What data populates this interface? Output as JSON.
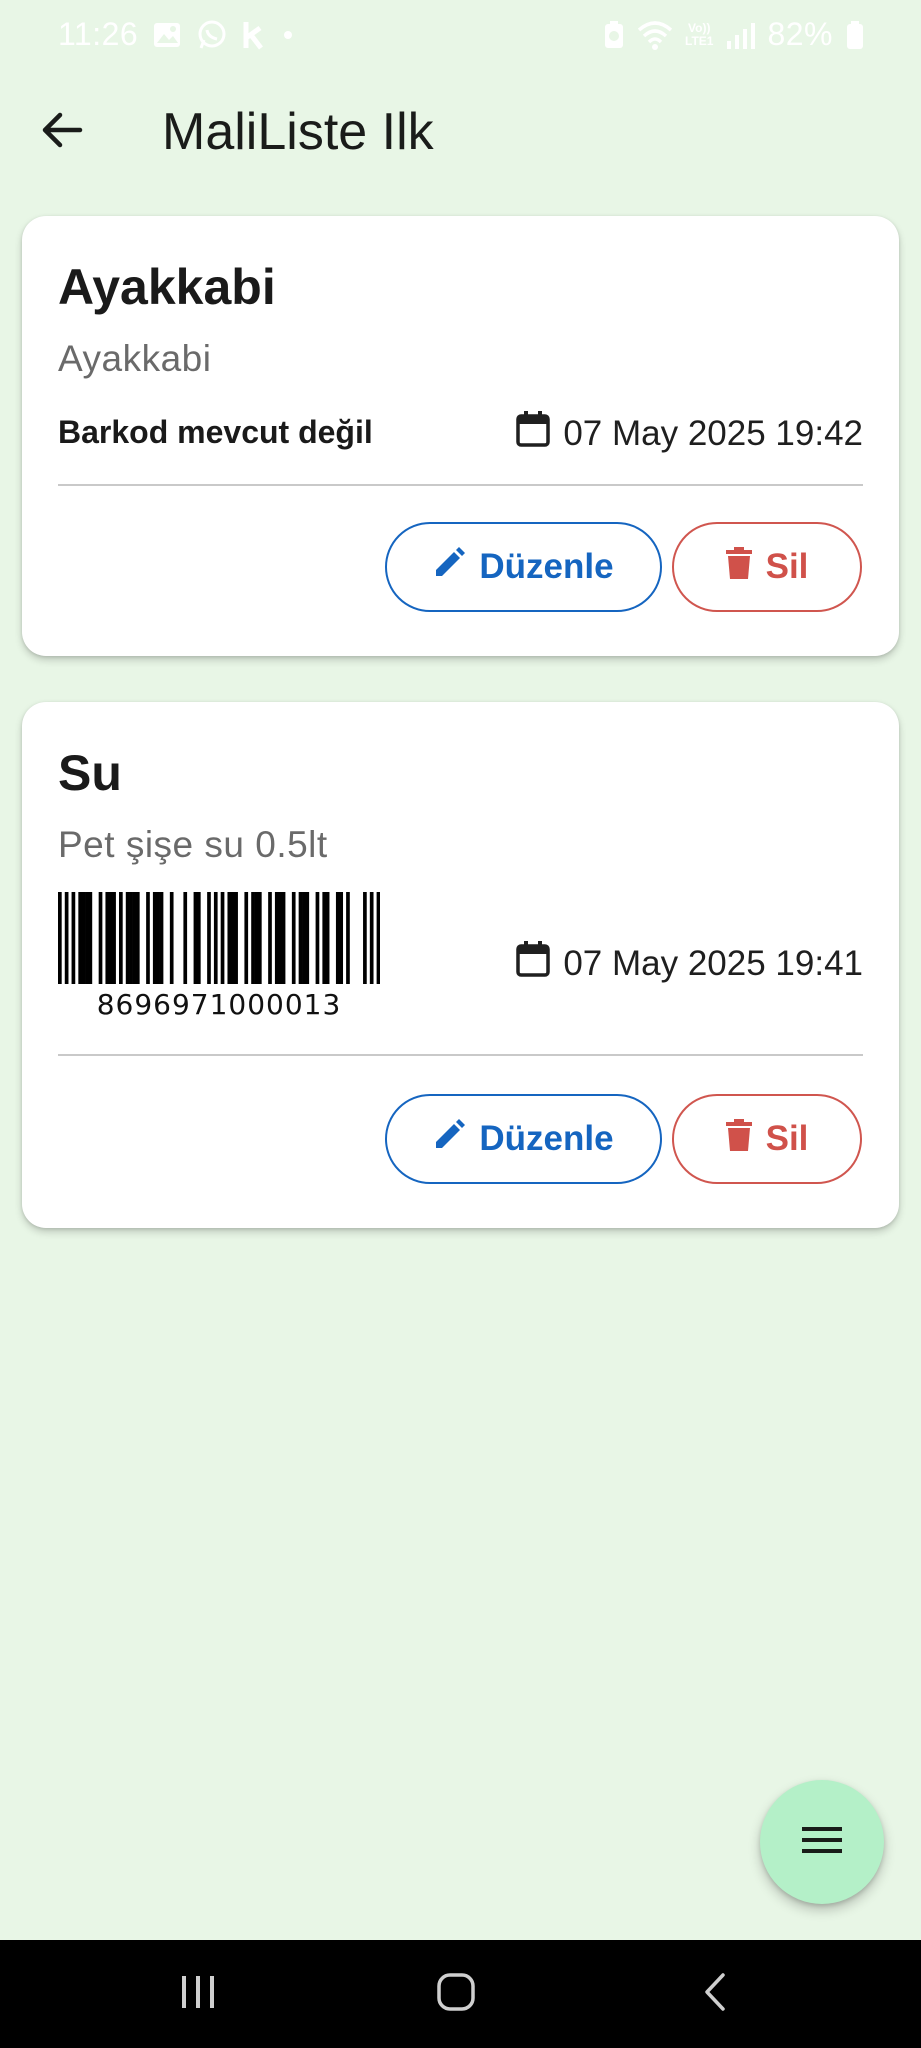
{
  "status_bar": {
    "time": "11:26",
    "battery": "82%",
    "icons": [
      "gallery-icon",
      "whatsapp-icon",
      "k-app-icon",
      "dot-icon",
      "battery-saver-icon",
      "wifi-icon",
      "volte-icon",
      "signal-icon",
      "battery-icon"
    ],
    "network_label_top": "Vo))",
    "network_label_bottom": "LTE1"
  },
  "app_bar": {
    "title": "MaliListe Ilk",
    "back_icon": "arrow-back-icon"
  },
  "items": [
    {
      "title": "Ayakkabi",
      "subtitle": "Ayakkabi",
      "barcode_text": "Barkod mevcut değil",
      "date": "07 May 2025 19:42",
      "edit_label": "Düzenle",
      "delete_label": "Sil"
    },
    {
      "title": "Su",
      "subtitle": "Pet şişe su 0.5lt",
      "barcode_number": "8696971000013",
      "date": "07 May 2025 19:41",
      "edit_label": "Düzenle",
      "delete_label": "Sil"
    }
  ],
  "colors": {
    "background": "#e8f6e6",
    "edit": "#1565c0",
    "delete": "#d0514a",
    "fab": "#b4f0c8"
  },
  "fab": {
    "icon": "menu-icon"
  },
  "nav_bar": {
    "icons": [
      "recents-icon",
      "home-icon",
      "back-nav-icon"
    ]
  }
}
